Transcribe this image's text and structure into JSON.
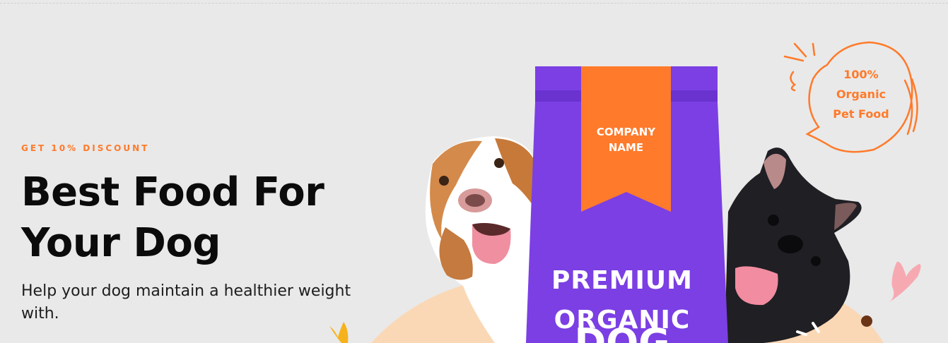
{
  "hero": {
    "eyebrow": "GET 10% DISCOUNT",
    "title_line1": "Best Food For",
    "title_line2": "Your Dog",
    "subtitle": "Help your dog maintain a healthier weight with."
  },
  "product": {
    "label_line1": "COMPANY",
    "label_line2": "NAME",
    "title_line1": "PREMIUM",
    "title_line2": "ORGANIC",
    "title_line3": "DOG"
  },
  "bubble": {
    "line1": "100%",
    "line2": "Organic",
    "line3": "Pet Food"
  },
  "colors": {
    "accent": "#ff7a2a",
    "bag_purple": "#7b3fe4",
    "backdrop_peach": "#fbd8b5",
    "background": "#e9e9e9"
  },
  "icons": [
    "beagle-dog-image",
    "french-bulldog-image",
    "heart-icon",
    "speech-bubble-icon",
    "sparkle-icon",
    "leaf-icon"
  ]
}
